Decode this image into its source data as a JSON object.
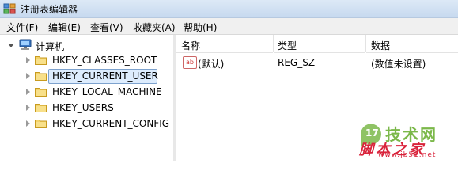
{
  "window": {
    "title": "注册表编辑器",
    "icon": "registry-editor-icon"
  },
  "menu": {
    "items": [
      {
        "label": "文件(F)"
      },
      {
        "label": "编辑(E)"
      },
      {
        "label": "查看(V)"
      },
      {
        "label": "收藏夹(A)"
      },
      {
        "label": "帮助(H)"
      }
    ]
  },
  "tree": {
    "root": {
      "label": "计算机",
      "icon": "computer-icon",
      "expanded": true
    },
    "nodes": [
      {
        "label": "HKEY_CLASSES_ROOT",
        "selected": false
      },
      {
        "label": "HKEY_CURRENT_USER",
        "selected": true
      },
      {
        "label": "HKEY_LOCAL_MACHINE",
        "selected": false
      },
      {
        "label": "HKEY_USERS",
        "selected": false
      },
      {
        "label": "HKEY_CURRENT_CONFIG",
        "selected": false
      }
    ]
  },
  "list": {
    "columns": [
      {
        "label": "名称"
      },
      {
        "label": "类型"
      },
      {
        "label": "数据"
      }
    ],
    "rows": [
      {
        "icon": "string-value-icon",
        "icon_text": "ab",
        "name": "(默认)",
        "type": "REG_SZ",
        "data": "(数值未设置)"
      }
    ]
  },
  "watermark": {
    "logo_text": "17",
    "site_name": "技术网",
    "tagline": "脚本之家",
    "url": "www.jb51.net",
    "colors": {
      "logo": "#7bb84a",
      "tagline": "#d9233b"
    }
  }
}
